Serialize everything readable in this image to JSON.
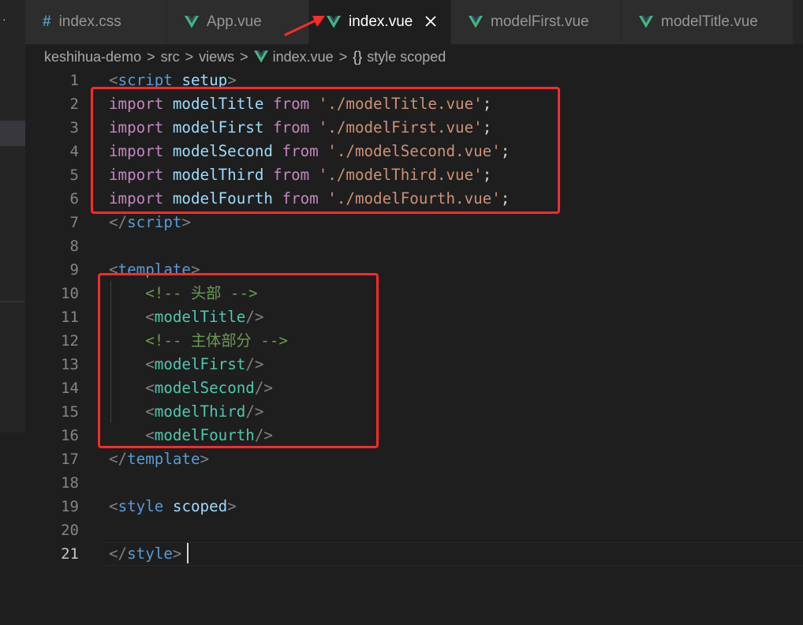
{
  "tabs": [
    {
      "label": "index.css",
      "icon": "hash-icon",
      "active": false
    },
    {
      "label": "App.vue",
      "icon": "vue-icon",
      "active": false
    },
    {
      "label": "index.vue",
      "icon": "vue-icon",
      "active": true
    },
    {
      "label": "modelFirst.vue",
      "icon": "vue-icon",
      "active": false
    },
    {
      "label": "modelTitle.vue",
      "icon": "vue-icon",
      "active": false
    }
  ],
  "tab_close_glyph": "✕",
  "breadcrumb": {
    "items": [
      "keshihua-demo",
      "src",
      "views",
      "index.vue",
      "style scoped"
    ],
    "separator": ">",
    "symbol_glyph": "{}"
  },
  "editor": {
    "current_line": 21,
    "line_numbers": [
      "1",
      "2",
      "3",
      "4",
      "5",
      "6",
      "7",
      "8",
      "9",
      "10",
      "11",
      "12",
      "13",
      "14",
      "15",
      "16",
      "17",
      "18",
      "19",
      "20",
      "21"
    ],
    "lines": [
      [
        {
          "t": "<",
          "c": "punc"
        },
        {
          "t": "script",
          "c": "tag"
        },
        {
          "t": " ",
          "c": "plain"
        },
        {
          "t": "setup",
          "c": "attr"
        },
        {
          "t": ">",
          "c": "punc"
        }
      ],
      [
        {
          "t": "import",
          "c": "kw"
        },
        {
          "t": " ",
          "c": "plain"
        },
        {
          "t": "modelTitle",
          "c": "var"
        },
        {
          "t": " ",
          "c": "plain"
        },
        {
          "t": "from",
          "c": "kw"
        },
        {
          "t": " ",
          "c": "plain"
        },
        {
          "t": "'./modelTitle.vue'",
          "c": "str"
        },
        {
          "t": ";",
          "c": "plain"
        }
      ],
      [
        {
          "t": "import",
          "c": "kw"
        },
        {
          "t": " ",
          "c": "plain"
        },
        {
          "t": "modelFirst",
          "c": "var"
        },
        {
          "t": " ",
          "c": "plain"
        },
        {
          "t": "from",
          "c": "kw"
        },
        {
          "t": " ",
          "c": "plain"
        },
        {
          "t": "'./modelFirst.vue'",
          "c": "str"
        },
        {
          "t": ";",
          "c": "plain"
        }
      ],
      [
        {
          "t": "import",
          "c": "kw"
        },
        {
          "t": " ",
          "c": "plain"
        },
        {
          "t": "modelSecond",
          "c": "var"
        },
        {
          "t": " ",
          "c": "plain"
        },
        {
          "t": "from",
          "c": "kw"
        },
        {
          "t": " ",
          "c": "plain"
        },
        {
          "t": "'./modelSecond.vue'",
          "c": "str"
        },
        {
          "t": ";",
          "c": "plain"
        }
      ],
      [
        {
          "t": "import",
          "c": "kw"
        },
        {
          "t": " ",
          "c": "plain"
        },
        {
          "t": "modelThird",
          "c": "var"
        },
        {
          "t": " ",
          "c": "plain"
        },
        {
          "t": "from",
          "c": "kw"
        },
        {
          "t": " ",
          "c": "plain"
        },
        {
          "t": "'./modelThird.vue'",
          "c": "str"
        },
        {
          "t": ";",
          "c": "plain"
        }
      ],
      [
        {
          "t": "import",
          "c": "kw"
        },
        {
          "t": " ",
          "c": "plain"
        },
        {
          "t": "modelFourth",
          "c": "var"
        },
        {
          "t": " ",
          "c": "plain"
        },
        {
          "t": "from",
          "c": "kw"
        },
        {
          "t": " ",
          "c": "plain"
        },
        {
          "t": "'./modelFourth.vue'",
          "c": "str"
        },
        {
          "t": ";",
          "c": "plain"
        }
      ],
      [
        {
          "t": "</",
          "c": "punc"
        },
        {
          "t": "script",
          "c": "tag"
        },
        {
          "t": ">",
          "c": "punc"
        }
      ],
      [],
      [
        {
          "t": "<",
          "c": "punc"
        },
        {
          "t": "template",
          "c": "tag"
        },
        {
          "t": ">",
          "c": "punc"
        }
      ],
      [
        {
          "t": "    ",
          "c": "plain"
        },
        {
          "t": "<!-- 头部 -->",
          "c": "com"
        }
      ],
      [
        {
          "t": "    ",
          "c": "plain"
        },
        {
          "t": "<",
          "c": "punc"
        },
        {
          "t": "modelTitle",
          "c": "comp"
        },
        {
          "t": "/>",
          "c": "punc"
        }
      ],
      [
        {
          "t": "    ",
          "c": "plain"
        },
        {
          "t": "<!-- 主体部分 -->",
          "c": "com"
        }
      ],
      [
        {
          "t": "    ",
          "c": "plain"
        },
        {
          "t": "<",
          "c": "punc"
        },
        {
          "t": "modelFirst",
          "c": "comp"
        },
        {
          "t": "/>",
          "c": "punc"
        }
      ],
      [
        {
          "t": "    ",
          "c": "plain"
        },
        {
          "t": "<",
          "c": "punc"
        },
        {
          "t": "modelSecond",
          "c": "comp"
        },
        {
          "t": "/>",
          "c": "punc"
        }
      ],
      [
        {
          "t": "    ",
          "c": "plain"
        },
        {
          "t": "<",
          "c": "punc"
        },
        {
          "t": "modelThird",
          "c": "comp"
        },
        {
          "t": "/>",
          "c": "punc"
        }
      ],
      [
        {
          "t": "    ",
          "c": "plain"
        },
        {
          "t": "<",
          "c": "punc"
        },
        {
          "t": "modelFourth",
          "c": "comp"
        },
        {
          "t": "/>",
          "c": "punc"
        }
      ],
      [
        {
          "t": "</",
          "c": "punc"
        },
        {
          "t": "template",
          "c": "tag"
        },
        {
          "t": ">",
          "c": "punc"
        }
      ],
      [],
      [
        {
          "t": "<",
          "c": "punc"
        },
        {
          "t": "style",
          "c": "tag"
        },
        {
          "t": " ",
          "c": "plain"
        },
        {
          "t": "scoped",
          "c": "attr"
        },
        {
          "t": ">",
          "c": "punc"
        }
      ],
      [],
      [
        {
          "t": "</",
          "c": "punc"
        },
        {
          "t": "style",
          "c": "tag"
        },
        {
          "t": ">",
          "c": "punc"
        }
      ]
    ]
  },
  "colors": {
    "editor_bg": "#1e1e1e",
    "tabbar_bg": "#252526",
    "highlight_box": "#ff2a2a",
    "vue_icon": "#41b883"
  }
}
